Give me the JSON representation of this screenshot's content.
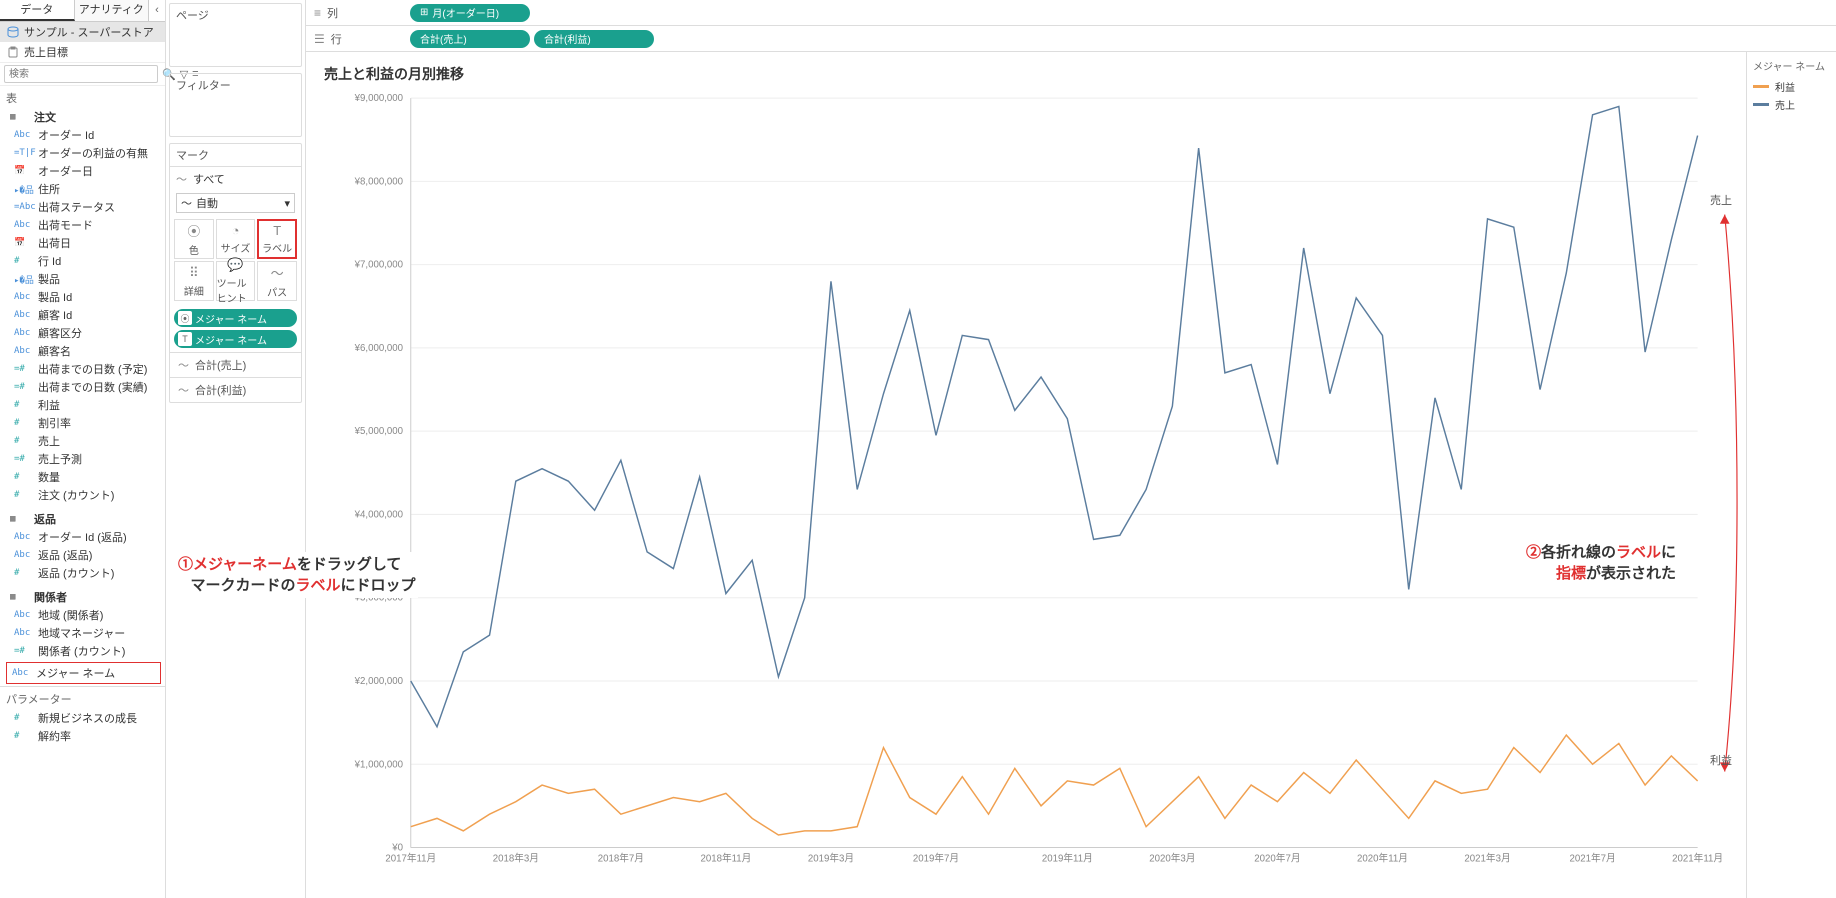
{
  "left": {
    "tab_data": "データ",
    "tab_analytics": "アナリティクス",
    "ds_primary": "サンプル - スーパーストア",
    "ds_secondary": "売上目標",
    "search_ph": "検索",
    "section_tables": "表",
    "folders": {
      "orders": "注文",
      "returns": "返品",
      "people": "関係者"
    },
    "fields": {
      "order_id": "オーダー Id",
      "order_profit_flag": "オーダーの利益の有無",
      "order_date": "オーダー日",
      "address": "住所",
      "ship_status": "出荷ステータス",
      "ship_mode": "出荷モード",
      "ship_date": "出荷日",
      "row_id": "行 Id",
      "product": "製品",
      "product_id": "製品 Id",
      "customer_id": "顧客 Id",
      "customer_segment": "顧客区分",
      "customer_name": "顧客名",
      "days_to_ship_plan": "出荷までの日数 (予定)",
      "days_to_ship_act": "出荷までの日数 (実績)",
      "profit": "利益",
      "discount": "割引率",
      "sales": "売上",
      "sales_forecast": "売上予測",
      "quantity": "数量",
      "orders_count": "注文 (カウント)",
      "return_order_id": "オーダー Id (返品)",
      "return_flag": "返品 (返品)",
      "returns_count": "返品 (カウント)",
      "region_people": "地域 (関係者)",
      "region_manager": "地域マネージャー",
      "people_count": "関係者 (カウント)",
      "measure_names": "メジャー ネーム"
    },
    "params_header": "パラメーター",
    "param1": "新規ビジネスの成長",
    "param2": "解約率"
  },
  "mid": {
    "pages": "ページ",
    "filters": "フィルター",
    "marks": "マーク",
    "marks_all": "すべて",
    "marks_auto": "自動",
    "cell_color": "色",
    "cell_size": "サイズ",
    "cell_label": "ラベル",
    "cell_detail": "詳細",
    "cell_tooltip": "ツールヒント",
    "cell_path": "パス",
    "pill_measure": "メジャー ネーム",
    "agg_sales": "合計(売上)",
    "agg_profit": "合計(利益)"
  },
  "shelves": {
    "cols": "列",
    "rows": "行",
    "col_pill": "月(オーダー日)",
    "row_pill1": "合計(売上)",
    "row_pill2": "合計(利益)"
  },
  "viz": {
    "title": "売上と利益の月別推移",
    "legend_title": "メジャー ネーム",
    "legend_profit": "利益",
    "legend_sales": "売上",
    "end_label_sales": "売上",
    "end_label_profit": "利益"
  },
  "anno": {
    "a1_pre": "①",
    "a1_b1": "メジャーネーム",
    "a1_t1": "をドラッグして",
    "a1_t2": "マークカードの",
    "a1_b2": "ラベル",
    "a1_t3": "にドロップ",
    "a2_pre": "②",
    "a2_t1": "各折れ線の",
    "a2_b1": "ラベル",
    "a2_t2": "に",
    "a2_b2": "指標",
    "a2_t3": "が表示された"
  },
  "chart_data": {
    "type": "line",
    "title": "売上と利益の月別推移",
    "ylabel": "",
    "ylim": [
      0,
      9000000
    ],
    "y_ticks": [
      "¥0",
      "¥1,000,000",
      "¥2,000,000",
      "¥3,000,000",
      "¥4,000,000",
      "¥5,000,000",
      "¥6,000,000",
      "¥7,000,000",
      "¥8,000,000",
      "¥9,000,000"
    ],
    "x_tick_labels": [
      "2017年11月",
      "2018年3月",
      "2018年7月",
      "2018年11月",
      "2019年3月",
      "2019年7月",
      "2019年11月",
      "2020年3月",
      "2020年7月",
      "2020年11月",
      "2021年3月",
      "2021年7月",
      "2021年11月"
    ],
    "categories": [
      "2017-11",
      "2017-12",
      "2018-01",
      "2018-02",
      "2018-03",
      "2018-04",
      "2018-05",
      "2018-06",
      "2018-07",
      "2018-08",
      "2018-09",
      "2018-10",
      "2018-11",
      "2018-12",
      "2019-01",
      "2019-02",
      "2019-03",
      "2019-04",
      "2019-05",
      "2019-06",
      "2019-07",
      "2019-08",
      "2019-09",
      "2019-10",
      "2019-11",
      "2019-12",
      "2020-01",
      "2020-02",
      "2020-03",
      "2020-04",
      "2020-05",
      "2020-06",
      "2020-07",
      "2020-08",
      "2020-09",
      "2020-10",
      "2020-11",
      "2020-12",
      "2021-01",
      "2021-02",
      "2021-03",
      "2021-04",
      "2021-05",
      "2021-06",
      "2021-07",
      "2021-08",
      "2021-09",
      "2021-10",
      "2021-11",
      "2021-12"
    ],
    "series": [
      {
        "name": "売上",
        "color": "#5b7d9e",
        "values": [
          2000000,
          1450000,
          2350000,
          2550000,
          4400000,
          4550000,
          4400000,
          4050000,
          4650000,
          3550000,
          3350000,
          4450000,
          3050000,
          3450000,
          2050000,
          3000000,
          6800000,
          4300000,
          5450000,
          6450000,
          4950000,
          6150000,
          6100000,
          5250000,
          5650000,
          5150000,
          3700000,
          3750000,
          4300000,
          5300000,
          8400000,
          5700000,
          5800000,
          4600000,
          7200000,
          5450000,
          6600000,
          6150000,
          3100000,
          5400000,
          4300000,
          7550000,
          7450000,
          5500000,
          6900000,
          8800000,
          8900000,
          5950000,
          7300000,
          8550000
        ]
      },
      {
        "name": "利益",
        "color": "#f0a050",
        "values": [
          250000,
          350000,
          200000,
          400000,
          550000,
          750000,
          650000,
          700000,
          400000,
          500000,
          600000,
          550000,
          650000,
          350000,
          150000,
          200000,
          200000,
          250000,
          1200000,
          600000,
          400000,
          850000,
          400000,
          950000,
          500000,
          800000,
          750000,
          950000,
          250000,
          550000,
          850000,
          350000,
          750000,
          550000,
          900000,
          650000,
          1050000,
          700000,
          350000,
          800000,
          650000,
          700000,
          1200000,
          900000,
          1350000,
          1000000,
          1250000,
          750000,
          1100000,
          800000
        ]
      }
    ]
  }
}
